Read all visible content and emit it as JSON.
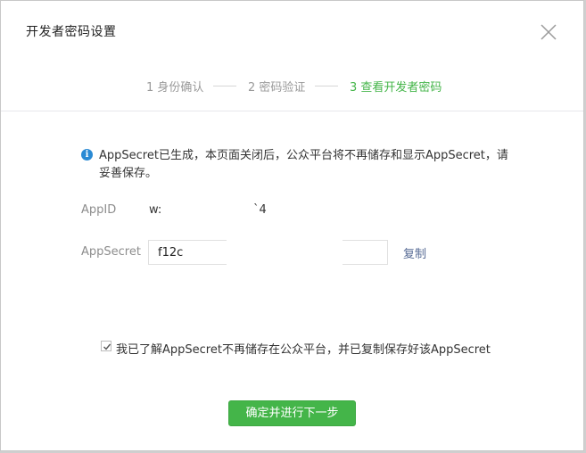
{
  "dialog": {
    "title": "开发者密码设置"
  },
  "steps": [
    {
      "label": "1 身份确认",
      "active": false
    },
    {
      "label": "2 密码验证",
      "active": false
    },
    {
      "label": "3 查看开发者密码",
      "active": true
    }
  ],
  "notice": {
    "icon": "info-icon",
    "text": "AppSecret已生成，本页面关闭后，公众平台将不再储存和显示AppSecret，请妥善保存。"
  },
  "fields": {
    "appid_label": "AppID",
    "appid_value": "w:",
    "appid_tail": "`4",
    "appsecret_label": "AppSecret",
    "appsecret_value": "f12c",
    "copy_label": "复制"
  },
  "agreement": {
    "checked": true,
    "text": "我已了解AppSecret不再储存在公众平台，并已复制保存好该AppSecret"
  },
  "actions": {
    "confirm_label": "确定并进行下一步"
  },
  "colors": {
    "accent": "#44b549",
    "link": "#576b95",
    "info": "#2a8ad4"
  }
}
